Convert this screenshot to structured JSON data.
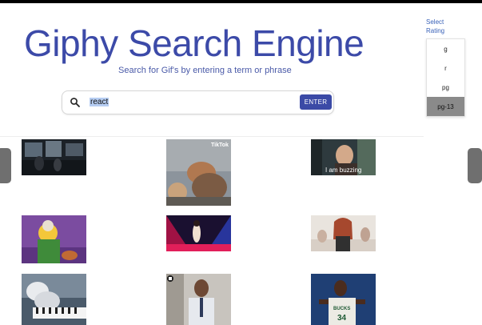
{
  "header": {
    "title": "Giphy Search Engine",
    "subtitle": "Search for Gif's by entering a term or phrase"
  },
  "search": {
    "value": "react",
    "enter_label": "ENTER"
  },
  "rating": {
    "label_line1": "Select",
    "label_line2": "Rating",
    "options": [
      "g",
      "r",
      "pg",
      "pg-13"
    ],
    "selected": "pg-13"
  },
  "gifs": {
    "g1": {
      "caption": ""
    },
    "g2": {
      "caption": "TikTok"
    },
    "g3": {
      "caption": "I am buzzing"
    },
    "g4": {
      "caption": ""
    },
    "g5": {
      "caption": ""
    },
    "g6": {
      "caption": ""
    },
    "g7": {
      "caption": ""
    },
    "g8": {
      "caption": ""
    },
    "g9": {
      "caption": "BUCKS"
    }
  },
  "colors": {
    "accent": "#3b4aa6",
    "title": "#3c4aa8",
    "selected_option": "#8a8a8a"
  }
}
